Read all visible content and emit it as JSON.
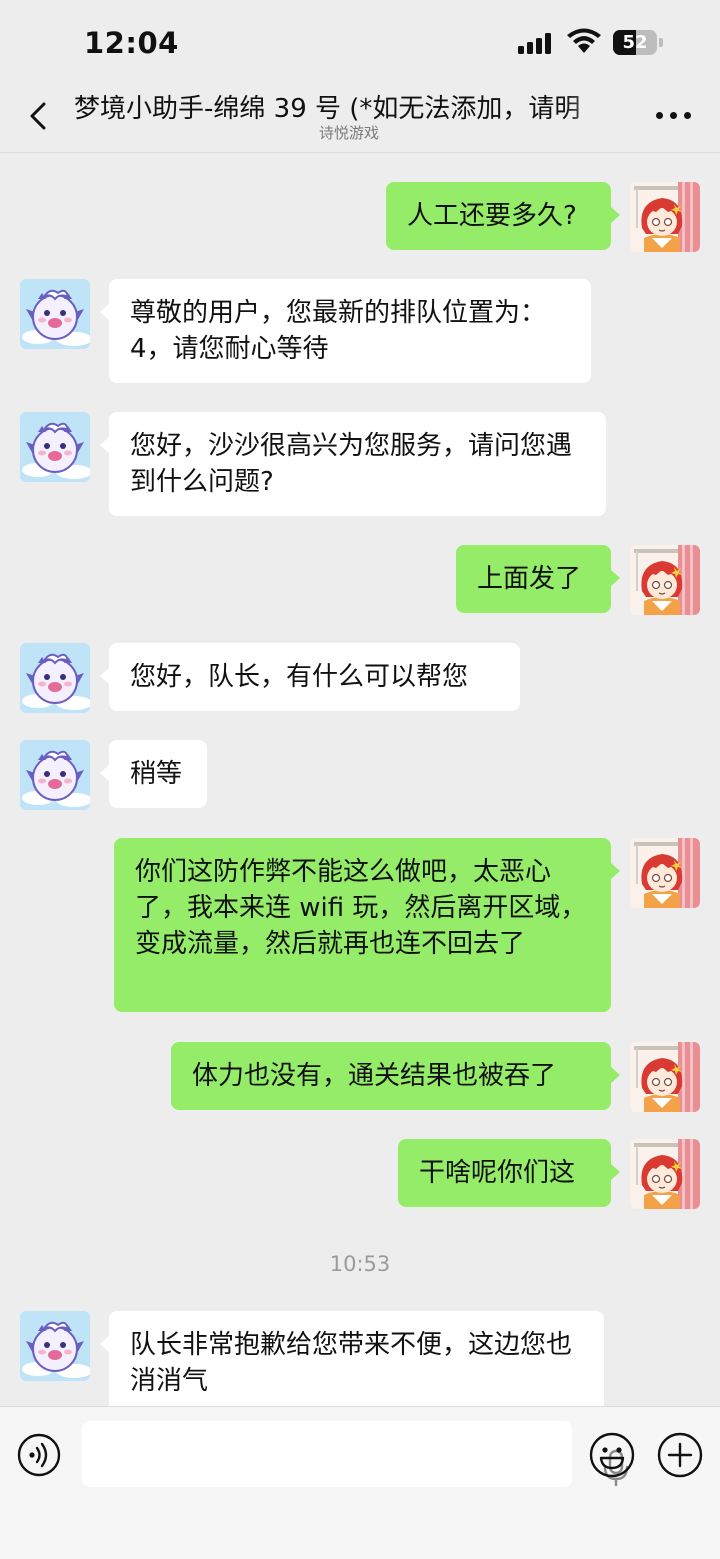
{
  "status": {
    "time": "12:04",
    "battery": "52",
    "battery_level": 0.52
  },
  "chat": {
    "title": "梦境小助手-绵绵 39 号 (*如无法添加，请明",
    "subtitle": "诗悦游戏"
  },
  "messages": [
    {
      "from": "me",
      "text": "人工还要多久?"
    },
    {
      "from": "bot",
      "text": "尊敬的用户，您最新的排队位置为：4，请您耐心等待"
    },
    {
      "from": "bot",
      "text": "您好，沙沙很高兴为您服务，请问您遇到什么问题?"
    },
    {
      "from": "me",
      "text": "上面发了"
    },
    {
      "from": "bot",
      "text": "您好，队长，有什么可以帮您"
    },
    {
      "from": "bot",
      "text": "稍等"
    },
    {
      "from": "me",
      "text": "你们这防作弊不能这么做吧，太恶心了，我本来连 wifi 玩，然后离开区域，变成流量，然后就再也连不回去了"
    },
    {
      "from": "me",
      "text": "体力也没有，通关结果也被吞了"
    },
    {
      "from": "me",
      "text": "干啥呢你们这"
    },
    {
      "from": "time",
      "text": "10:53"
    },
    {
      "from": "bot",
      "text": "队长非常抱歉给您带来不便，这边您也消消气"
    }
  ],
  "colors": {
    "bubble_out": "#95ec69",
    "bubble_in": "#ffffff",
    "background": "#ededed"
  },
  "icons": {
    "back": "chevron-left-icon",
    "more": "more-dots-icon",
    "voice": "voice-mode-icon",
    "mic": "microphone-icon",
    "emoji": "emoji-icon",
    "plus": "plus-icon"
  }
}
